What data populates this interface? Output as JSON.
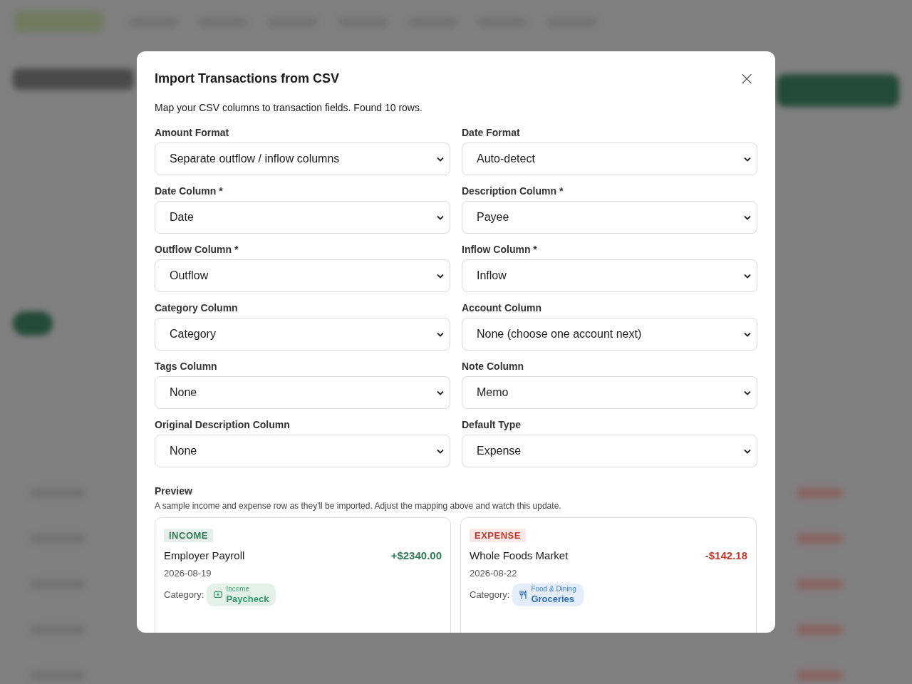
{
  "dialog": {
    "title": "Import Transactions from CSV",
    "close_icon": "×",
    "description": "Map your CSV columns to transaction fields. Found 10 rows.",
    "fields": [
      {
        "label": "Amount Format",
        "value": "Separate outflow / inflow columns"
      },
      {
        "label": "Date Format",
        "value": "Auto-detect"
      },
      {
        "label": "Date Column *",
        "value": "Date"
      },
      {
        "label": "Description Column *",
        "value": "Payee"
      },
      {
        "label": "Outflow Column *",
        "value": "Outflow"
      },
      {
        "label": "Inflow Column *",
        "value": "Inflow"
      },
      {
        "label": "Category Column",
        "value": "Category"
      },
      {
        "label": "Account Column",
        "value": "None (choose one account next)"
      },
      {
        "label": "Tags Column",
        "value": "None"
      },
      {
        "label": "Note Column",
        "value": "Memo"
      },
      {
        "label": "Original Description Column",
        "value": "None"
      },
      {
        "label": "Default Type",
        "value": "Expense"
      }
    ],
    "preview": {
      "title": "Preview",
      "description": "A sample income and expense row as they'll be imported. Adjust the mapping above and watch this update.",
      "cards": [
        {
          "kind": "income",
          "badge": "INCOME",
          "name": "Employer Payroll",
          "amount": "+$2340.00",
          "date": "2026-08-19",
          "category_label": "Category:",
          "category_group": "Income",
          "category_name": "Paycheck"
        },
        {
          "kind": "expense",
          "badge": "EXPENSE",
          "name": "Whole Foods Market",
          "amount": "-$142.18",
          "date": "2026-08-22",
          "category_label": "Category:",
          "category_group": "Food & Dining",
          "category_name": "Groceries"
        }
      ]
    }
  }
}
